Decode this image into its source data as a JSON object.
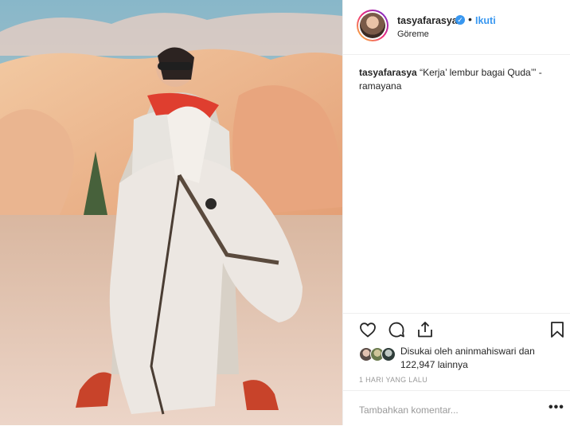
{
  "post": {
    "image_alt": "Woman in sunglasses and red scarf riding a white horse in Göreme",
    "author": {
      "username": "tasyafarasya",
      "verified_mark": "✓",
      "separator": "•",
      "follow_label": "Ikuti",
      "location": "Göreme"
    },
    "caption": {
      "username": "tasyafarasya",
      "text": " “Kerja’ lembur bagai Quda’” - ramayana"
    },
    "actions": {
      "like_icon": "heart-icon",
      "comment_icon": "comment-icon",
      "share_icon": "share-icon",
      "save_icon": "bookmark-icon"
    },
    "likes": {
      "text": "Disukai oleh aninmahiswari dan 122,947 lainnya"
    },
    "timestamp": "1 HARI YANG LALU",
    "comment": {
      "placeholder": "Tambahkan komentar...",
      "more_label": "•••"
    },
    "colors": {
      "accent": "#3897f0",
      "text": "#262626",
      "muted": "#999999"
    }
  }
}
